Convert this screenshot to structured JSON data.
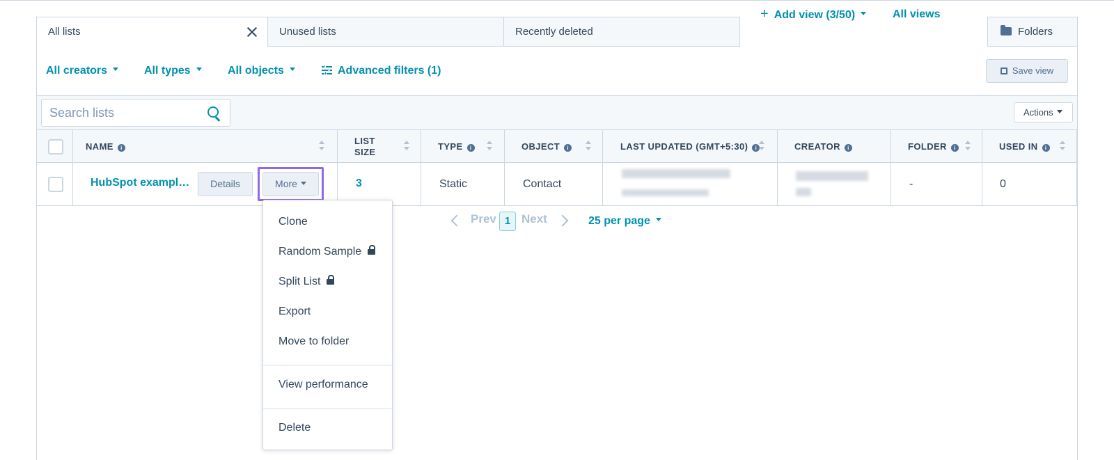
{
  "tabs": [
    {
      "label": "All lists",
      "active": true
    },
    {
      "label": "Unused lists",
      "active": false
    },
    {
      "label": "Recently deleted",
      "active": false
    }
  ],
  "header": {
    "add_view": "Add view (3/50)",
    "all_views": "All views",
    "folders": "Folders"
  },
  "filters": {
    "creators": "All creators",
    "types": "All types",
    "objects": "All objects",
    "advanced": "Advanced filters (1)",
    "save_view": "Save view"
  },
  "search": {
    "placeholder": "Search lists"
  },
  "toolbar": {
    "actions": "Actions"
  },
  "table": {
    "columns": [
      "NAME",
      "LIST SIZE",
      "TYPE",
      "OBJECT",
      "LAST UPDATED (GMT+5:30)",
      "CREATOR",
      "FOLDER",
      "USED IN"
    ],
    "list_size_lines": [
      "LIST",
      "SIZE"
    ],
    "rows": [
      {
        "name": "HubSpot exampl…",
        "details": "Details",
        "more": "More",
        "list_size": "3",
        "type": "Static",
        "object": "Contact",
        "folder": "-",
        "used_in": "0"
      }
    ]
  },
  "pagination": {
    "prev": "Prev",
    "page": "1",
    "next": "Next",
    "per_page": "25 per page"
  },
  "menu": {
    "items": [
      "Clone",
      "Random Sample",
      "Split List",
      "Export",
      "Move to folder",
      "View performance",
      "Delete"
    ]
  },
  "colors": {
    "accent": "#0091ae",
    "text": "#33475b",
    "border": "#cbd6e2",
    "highlight": "#8c6ce0"
  }
}
